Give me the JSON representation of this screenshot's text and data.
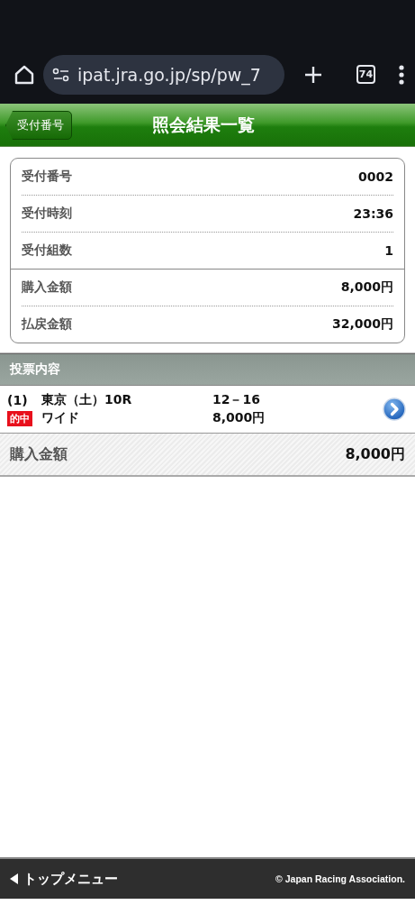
{
  "browser": {
    "url": "ipat.jra.go.jp/sp/pw_7",
    "tab_count": "74"
  },
  "header": {
    "back_label": "受付番号",
    "title": "照会結果一覧"
  },
  "summary": {
    "groups": [
      {
        "rows": [
          {
            "label": "受付番号",
            "value": "0002"
          },
          {
            "label": "受付時刻",
            "value": "23:36"
          },
          {
            "label": "受付組数",
            "value": "1"
          }
        ]
      },
      {
        "rows": [
          {
            "label": "購入金額",
            "value": "8,000円"
          },
          {
            "label": "払戻金額",
            "value": "32,000円"
          }
        ]
      }
    ]
  },
  "bets": {
    "title": "投票内容",
    "items": [
      {
        "number": "(1)",
        "race": "東京（土）10R",
        "combination": "12－16",
        "badge": "的中",
        "type": "ワイド",
        "amount": "8,000円"
      }
    ],
    "total_label": "購入金額",
    "total_value": "8,000円"
  },
  "footer": {
    "back_label": "トップメニュー",
    "copyright": "© Japan Racing Association."
  }
}
